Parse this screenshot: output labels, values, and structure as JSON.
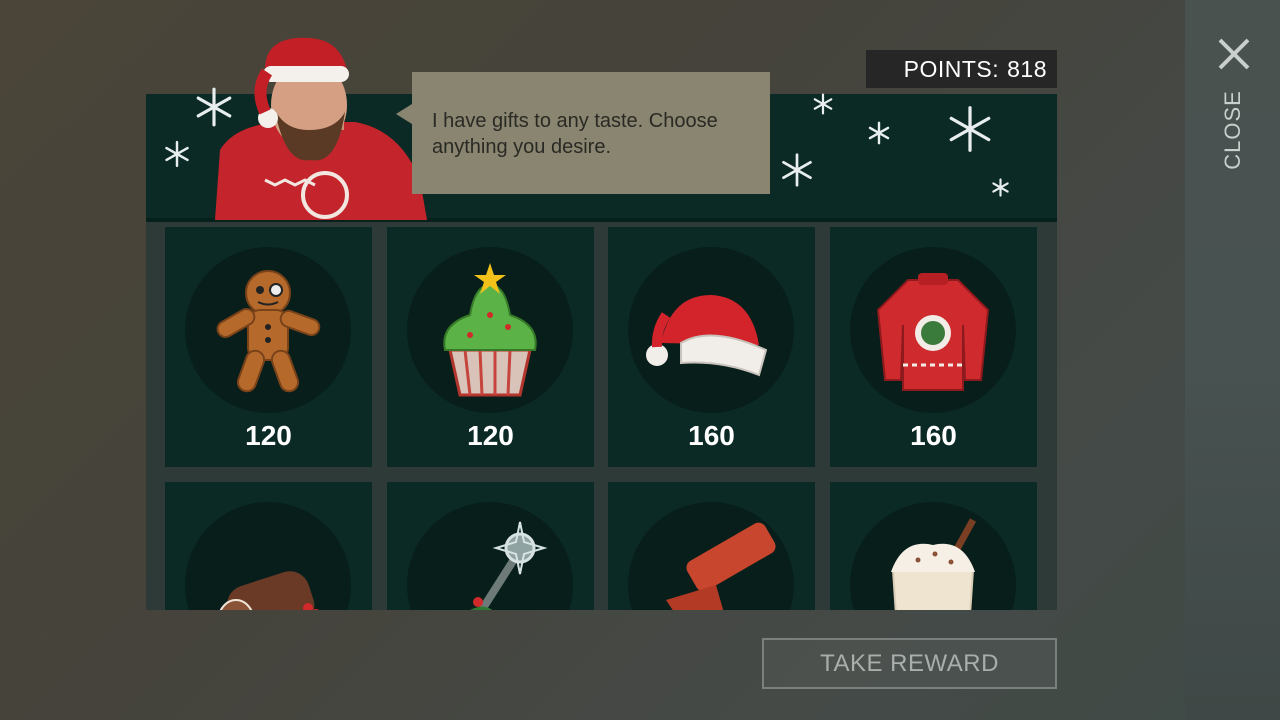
{
  "header": {
    "points_label": "POINTS:",
    "points_value": "818",
    "close_label": "CLOSE"
  },
  "dialog": {
    "message": "I have gifts to any taste. Choose anything you desire."
  },
  "items": [
    {
      "name": "gingerbread-man",
      "icon": "gingerbread-icon",
      "price": "120"
    },
    {
      "name": "christmas-cupcake",
      "icon": "cupcake-icon",
      "price": "120"
    },
    {
      "name": "santa-hat",
      "icon": "santa-hat-icon",
      "price": "160"
    },
    {
      "name": "christmas-sweater",
      "icon": "sweater-icon",
      "price": "160"
    },
    {
      "name": "yule-log",
      "icon": "yule-log-icon",
      "price": ""
    },
    {
      "name": "festive-staff",
      "icon": "staff-icon",
      "price": ""
    },
    {
      "name": "flare-gun",
      "icon": "flare-gun-icon",
      "price": ""
    },
    {
      "name": "eggnog",
      "icon": "eggnog-icon",
      "price": ""
    }
  ],
  "footer": {
    "take_reward_label": "TAKE REWARD"
  },
  "colors": {
    "panel_dark_green": "#0b2a26",
    "bubble": "#8a8571",
    "accent_red": "#d12a2a"
  }
}
